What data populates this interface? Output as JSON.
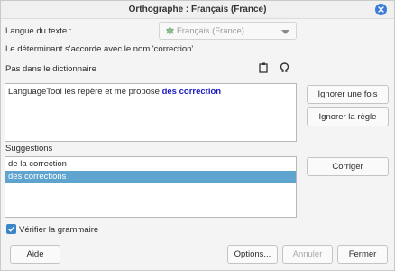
{
  "window": {
    "title": "Orthographe : Français (France)"
  },
  "language": {
    "label": "Langue du texte :",
    "value": "Français (France)"
  },
  "rule_message": "Le déterminant s'accorde avec le nom 'correction'.",
  "not_in_dict": {
    "label": "Pas dans le dictionnaire"
  },
  "sentence": {
    "prefix": "LanguageTool les repère et me propose ",
    "error": "des correction"
  },
  "suggestions": {
    "label": "Suggestions",
    "items": [
      "de la correction",
      "des corrections"
    ],
    "selected_index": 1
  },
  "buttons": {
    "ignore_once": "Ignorer une fois",
    "ignore_rule": "Ignorer la règle",
    "correct": "Corriger",
    "help": "Aide",
    "options": "Options...",
    "undo": "Annuler",
    "close": "Fermer"
  },
  "check_grammar": {
    "label": "Vérifier la grammaire",
    "checked": true
  },
  "icons": {
    "close": "close-icon",
    "clipboard": "clipboard-icon",
    "special_char": "omega-icon",
    "flag": "flag-icon",
    "dropdown": "chevron-down-icon",
    "check": "checkmark-icon"
  },
  "colors": {
    "accent": "#3a86c8",
    "selection": "#5fa3cf",
    "error_text": "#1a1ac0"
  }
}
